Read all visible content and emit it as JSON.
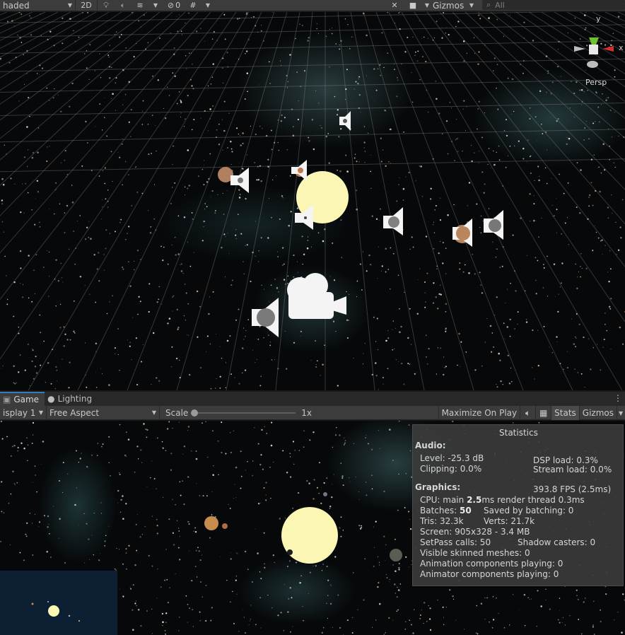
{
  "scene_toolbar": {
    "shading_mode": "haded",
    "btn_2d": "2D",
    "hidden_count": "0",
    "gizmos": "Gizmos",
    "search_placeholder": "All"
  },
  "scene_view": {
    "gizmo_persp": "Persp",
    "axis_y": "y",
    "axis_x": "x"
  },
  "game_panel": {
    "tabs": [
      {
        "label": "Game"
      },
      {
        "label": "Lighting"
      }
    ],
    "display": "isplay 1",
    "aspect": "Free Aspect",
    "scale_label": "Scale",
    "scale_value": "1x",
    "maximize_on_play": "Maximize On Play",
    "stats": "Stats",
    "gizmos": "Gizmos"
  },
  "statistics": {
    "title": "Statistics",
    "audio_header": "Audio:",
    "level": "Level: -25.3 dB",
    "clipping": "Clipping: 0.0%",
    "dsp_load": "DSP load: 0.3%",
    "stream_load": "Stream load: 0.0%",
    "graphics_header": "Graphics:",
    "fps": "393.8 FPS (2.5ms)",
    "cpu_prefix": "CPU: main ",
    "cpu_main": "2.5",
    "cpu_suffix": "ms  render thread 0.3ms",
    "batches_prefix": "Batches: ",
    "batches": "50",
    "saved_by_batching": "Saved by batching: 0",
    "tris": "Tris: 32.3k",
    "verts": "Verts: 21.7k",
    "screen": "Screen: 905x328 - 3.4 MB",
    "setpass": "SetPass calls: 50",
    "shadow_casters": "Shadow casters: 0",
    "visible_skinned": "Visible skinned meshes: 0",
    "animation_components": "Animation components playing: 0",
    "animator_components": "Animator components playing: 0"
  },
  "colors": {
    "sun": "#fbf6b4",
    "accent_tab": "#3a79bb",
    "stats_bg": "#3a3a3a"
  }
}
